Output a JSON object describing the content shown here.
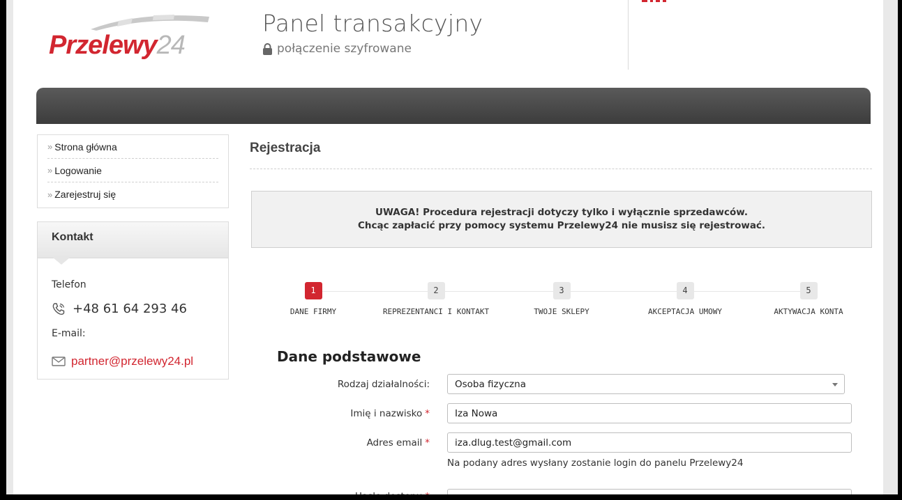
{
  "header": {
    "logo_brand": "Przelewy",
    "logo_number": "24",
    "panel_title": "Panel transakcyjny",
    "panel_subtitle": "połączenie szyfrowane"
  },
  "sidebar": {
    "menu": [
      {
        "label": "Strona główna"
      },
      {
        "label": "Logowanie"
      },
      {
        "label": "Zarejestruj się"
      }
    ],
    "contact": {
      "title": "Kontakt",
      "phone_label": "Telefon",
      "phone": "+48 61 64 293 46",
      "email_label": "E-mail:",
      "email": "partner@przelewy24.pl"
    }
  },
  "main": {
    "title": "Rejestracja",
    "notice_line1": "UWAGA! Procedura rejestracji dotyczy tylko i wyłącznie sprzedawców.",
    "notice_line2": "Chcąc zapłacić przy pomocy systemu Przelewy24 nie musisz się rejestrować.",
    "steps": [
      {
        "number": "1",
        "label": "DANE FIRMY",
        "active": true
      },
      {
        "number": "2",
        "label": "REPREZENTANCI I KONTAKT",
        "active": false
      },
      {
        "number": "3",
        "label": "TWOJE SKLEPY",
        "active": false
      },
      {
        "number": "4",
        "label": "AKCEPTACJA UMOWY",
        "active": false
      },
      {
        "number": "5",
        "label": "AKTYWACJA KONTA",
        "active": false
      }
    ],
    "section_title": "Dane podstawowe",
    "form": {
      "business_type_label": "Rodzaj działalności:",
      "business_type_value": "Osoba fizyczna",
      "name_label": "Imię i nazwisko",
      "name_value": "Iza Nowa",
      "email_label": "Adres email",
      "email_value": "iza.dlug.test@gmail.com",
      "email_hint": "Na podany adres wysłany zostanie login do panelu Przelewy24",
      "password_label": "Hasło dostępu",
      "required_mark": "*"
    }
  },
  "colors": {
    "brand_red": "#d22630",
    "navbar_dark": "#454545"
  }
}
